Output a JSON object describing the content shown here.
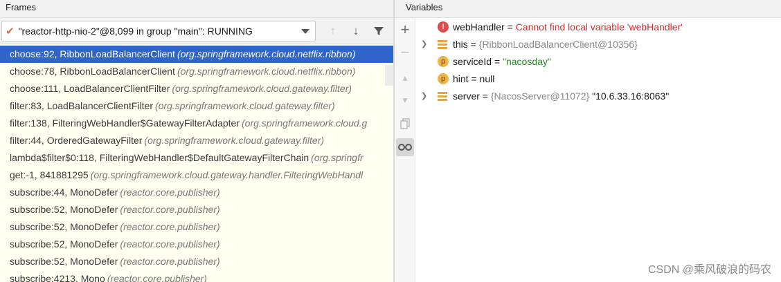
{
  "frames_panel": {
    "title": "Frames",
    "thread_selector": {
      "value": "\"reactor-http-nio-2\"@8,099 in group \"main\": RUNNING"
    },
    "frames": [
      {
        "method": "choose:92, RibbonLoadBalancerClient",
        "package": "(org.springframework.cloud.netflix.ribbon)",
        "selected": true
      },
      {
        "method": "choose:78, RibbonLoadBalancerClient",
        "package": "(org.springframework.cloud.netflix.ribbon)"
      },
      {
        "method": "choose:111, LoadBalancerClientFilter",
        "package": "(org.springframework.cloud.gateway.filter)"
      },
      {
        "method": "filter:83, LoadBalancerClientFilter",
        "package": "(org.springframework.cloud.gateway.filter)"
      },
      {
        "method": "filter:138, FilteringWebHandler$GatewayFilterAdapter",
        "package": "(org.springframework.cloud.g"
      },
      {
        "method": "filter:44, OrderedGatewayFilter",
        "package": "(org.springframework.cloud.gateway.filter)"
      },
      {
        "method": "lambda$filter$0:118, FilteringWebHandler$DefaultGatewayFilterChain",
        "package": "(org.springfr"
      },
      {
        "method": "get:-1, 841881295",
        "package": "(org.springframework.cloud.gateway.handler.FilteringWebHandl"
      },
      {
        "method": "subscribe:44, MonoDefer",
        "package": "(reactor.core.publisher)"
      },
      {
        "method": "subscribe:52, MonoDefer",
        "package": "(reactor.core.publisher)"
      },
      {
        "method": "subscribe:52, MonoDefer",
        "package": "(reactor.core.publisher)"
      },
      {
        "method": "subscribe:52, MonoDefer",
        "package": "(reactor.core.publisher)"
      },
      {
        "method": "subscribe:52, MonoDefer",
        "package": "(reactor.core.publisher)"
      },
      {
        "method": "subscribe:4213, Mono",
        "package": "(reactor.core.publisher)"
      }
    ]
  },
  "variables_panel": {
    "title": "Variables",
    "variables": [
      {
        "icon": "error-icon",
        "expandable": false,
        "name": "webHandler",
        "eq": " = ",
        "value": "Cannot find local variable 'webHandler'",
        "value_kind": "error",
        "extra": ""
      },
      {
        "icon": "field-icon",
        "expandable": true,
        "name": "this",
        "eq": " = ",
        "value": "{RibbonLoadBalancerClient@10356}",
        "value_kind": "type",
        "extra": ""
      },
      {
        "icon": "parameter-icon",
        "expandable": false,
        "name": "serviceId",
        "eq": " = ",
        "value": "\"nacosday\"",
        "value_kind": "string",
        "extra": ""
      },
      {
        "icon": "parameter-icon",
        "expandable": false,
        "name": "hint",
        "eq": " = ",
        "value": "null",
        "value_kind": "plain",
        "extra": ""
      },
      {
        "icon": "field-icon",
        "expandable": true,
        "name": "server",
        "eq": " = ",
        "value": "{NacosServer@11072}",
        "value_kind": "type",
        "extra": " \"10.6.33.16:8063\""
      }
    ]
  },
  "watermark": "CSDN @乘风破浪的码农",
  "colors": {
    "selection": "#2f65ca",
    "frames_background": "#fffff0",
    "error_text": "#d02d2d",
    "string_value": "#1f8b1f"
  }
}
